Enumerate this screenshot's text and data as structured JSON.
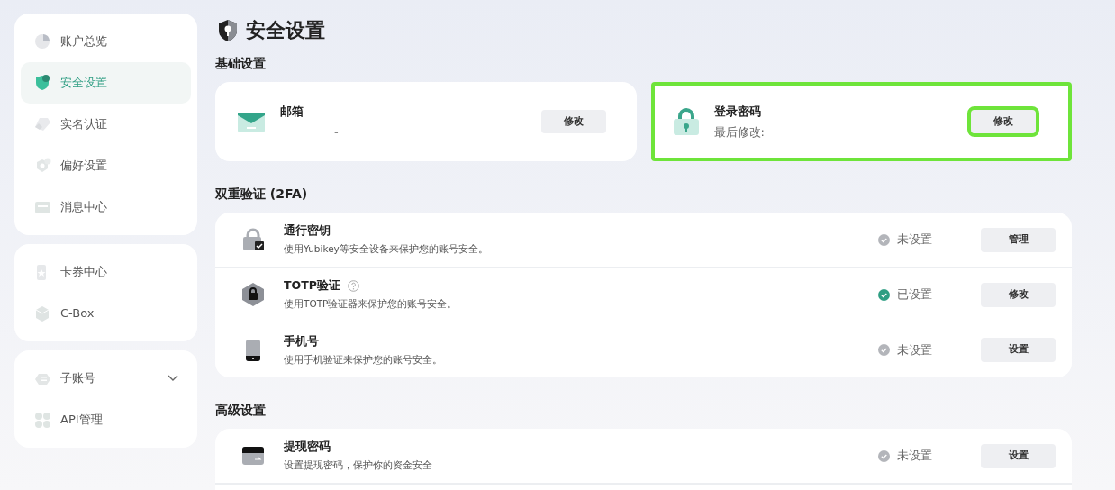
{
  "sidebar": {
    "groups": [
      {
        "items": [
          {
            "label": "账户总览",
            "selected": false
          },
          {
            "label": "安全设置",
            "selected": true
          },
          {
            "label": "实名认证",
            "selected": false
          },
          {
            "label": "偏好设置",
            "selected": false
          },
          {
            "label": "消息中心",
            "selected": false
          }
        ]
      },
      {
        "items": [
          {
            "label": "卡券中心",
            "selected": false
          },
          {
            "label": "C-Box",
            "selected": false
          }
        ]
      },
      {
        "items": [
          {
            "label": "子账号",
            "selected": false,
            "expanded": false
          },
          {
            "label": "API管理",
            "selected": false
          }
        ]
      }
    ]
  },
  "page_title": "安全设置",
  "basic": {
    "heading": "基础设置",
    "cards": [
      {
        "title": "邮箱",
        "subtitle": "-",
        "button": "修改",
        "highlighted": false
      },
      {
        "title": "登录密码",
        "subtitle": "最后修改:",
        "button": "修改",
        "highlighted": true
      }
    ]
  },
  "two_factor": {
    "heading": "双重验证 (2FA)",
    "rows": [
      {
        "title": "通行密钥",
        "help": false,
        "description": "使用Yubikey等安全设备来保护您的账号安全。",
        "status": "未设置",
        "done": false,
        "button": "管理"
      },
      {
        "title": "TOTP验证",
        "help": true,
        "description": "使用TOTP验证器来保护您的账号安全。",
        "status": "已设置",
        "done": true,
        "button": "修改"
      },
      {
        "title": "手机号",
        "help": false,
        "description": "使用手机验证来保护您的账号安全。",
        "status": "未设置",
        "done": false,
        "button": "设置"
      }
    ]
  },
  "advanced": {
    "heading": "高级设置",
    "rows": [
      {
        "title": "提现密码",
        "help": false,
        "description": "设置提现密码，保护你的资金安全",
        "status": "未设置",
        "done": false,
        "button": "设置"
      }
    ]
  }
}
